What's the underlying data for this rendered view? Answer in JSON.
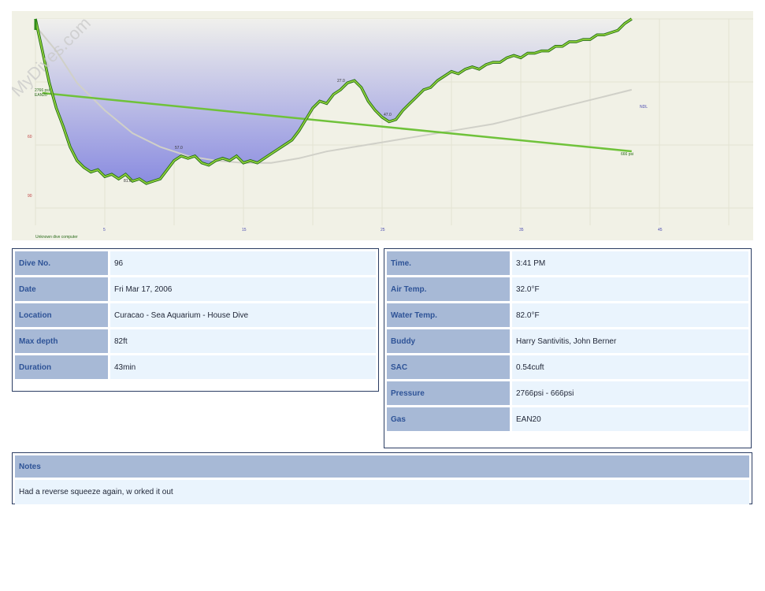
{
  "profile": {
    "watermark": "MyDives.com",
    "computer": "Unknown dive computer",
    "x_ticks": [
      "5",
      "15",
      "25",
      "35",
      "45"
    ],
    "y_ticks": [
      "60",
      "90"
    ],
    "labels": {
      "start_pressure": "2766 psi",
      "gas": "EAN20",
      "end_pressure": "666 psi",
      "ndl": "NDL",
      "max_depth": "81.0",
      "depth_mid": "57.0",
      "depth_rise": "47.0",
      "depth_peak": "27.0"
    },
    "colors": {
      "background": "#f1f1e6",
      "depth_line": "#2e8b1a",
      "depth_fill": "#8a8ce0",
      "pressure_line": "#6fc23a",
      "ndl_line": "#d0d0c8"
    },
    "depth_points": [
      [
        0.0,
        0
      ],
      [
        0.5,
        14
      ],
      [
        1.0,
        28
      ],
      [
        1.5,
        39
      ],
      [
        2.0,
        47
      ],
      [
        2.5,
        56
      ],
      [
        3.0,
        62
      ],
      [
        3.5,
        65
      ],
      [
        4.0,
        67
      ],
      [
        4.5,
        66
      ],
      [
        5.0,
        69
      ],
      [
        5.5,
        68
      ],
      [
        6.0,
        70
      ],
      [
        6.5,
        68
      ],
      [
        7.0,
        71
      ],
      [
        7.5,
        70
      ],
      [
        8.0,
        72
      ],
      [
        8.5,
        71
      ],
      [
        9.0,
        70
      ],
      [
        9.5,
        66
      ],
      [
        10.0,
        62
      ],
      [
        10.5,
        60
      ],
      [
        11.0,
        61
      ],
      [
        11.5,
        60
      ],
      [
        12.0,
        63
      ],
      [
        12.5,
        64
      ],
      [
        13.0,
        62
      ],
      [
        13.5,
        61
      ],
      [
        14.0,
        62
      ],
      [
        14.5,
        60
      ],
      [
        15.0,
        63
      ],
      [
        15.5,
        62
      ],
      [
        16.0,
        63
      ],
      [
        16.5,
        61
      ],
      [
        17.0,
        59
      ],
      [
        17.5,
        57
      ],
      [
        18.0,
        55
      ],
      [
        18.5,
        53
      ],
      [
        19.0,
        49
      ],
      [
        19.5,
        44
      ],
      [
        20.0,
        39
      ],
      [
        20.5,
        36
      ],
      [
        21.0,
        37
      ],
      [
        21.5,
        33
      ],
      [
        22.0,
        31
      ],
      [
        22.5,
        28
      ],
      [
        23.0,
        27
      ],
      [
        23.5,
        30
      ],
      [
        24.0,
        36
      ],
      [
        24.5,
        40
      ],
      [
        25.0,
        43
      ],
      [
        25.5,
        45
      ],
      [
        26.0,
        44
      ],
      [
        26.5,
        40
      ],
      [
        27.0,
        37
      ],
      [
        27.5,
        34
      ],
      [
        28.0,
        31
      ],
      [
        28.5,
        30
      ],
      [
        29.0,
        27
      ],
      [
        29.5,
        25
      ],
      [
        30.0,
        23
      ],
      [
        30.5,
        24
      ],
      [
        31.0,
        22
      ],
      [
        31.5,
        21
      ],
      [
        32.0,
        22
      ],
      [
        32.5,
        20
      ],
      [
        33.0,
        19
      ],
      [
        33.5,
        19
      ],
      [
        34.0,
        17
      ],
      [
        34.5,
        16
      ],
      [
        35.0,
        17
      ],
      [
        35.5,
        15
      ],
      [
        36.0,
        15
      ],
      [
        36.5,
        14
      ],
      [
        37.0,
        14
      ],
      [
        37.5,
        12
      ],
      [
        38.0,
        12
      ],
      [
        38.5,
        10
      ],
      [
        39.0,
        10
      ],
      [
        39.5,
        9
      ],
      [
        40.0,
        9
      ],
      [
        40.5,
        7
      ],
      [
        41.0,
        7
      ],
      [
        41.5,
        6
      ],
      [
        42.0,
        5
      ],
      [
        42.5,
        2
      ],
      [
        43.0,
        0
      ]
    ],
    "pressure_points": [
      [
        0.5,
        2766
      ],
      [
        43.0,
        666
      ]
    ],
    "ndl_points": [
      [
        0,
        3
      ],
      [
        1.5,
        14
      ],
      [
        3,
        28
      ],
      [
        5,
        40
      ],
      [
        7,
        50
      ],
      [
        9,
        56
      ],
      [
        11,
        60
      ],
      [
        13,
        62
      ],
      [
        15,
        63
      ],
      [
        17,
        63
      ],
      [
        19,
        61
      ],
      [
        21,
        58
      ],
      [
        23,
        56
      ],
      [
        25,
        54
      ],
      [
        27,
        52
      ],
      [
        29,
        50
      ],
      [
        31,
        48
      ],
      [
        33,
        46
      ],
      [
        35,
        43
      ],
      [
        37,
        40
      ],
      [
        39,
        37
      ],
      [
        41,
        34
      ],
      [
        43,
        31
      ]
    ]
  },
  "details": {
    "dive_no_label": "Dive No.",
    "dive_no": "96",
    "date_label": "Date",
    "date": "Fri Mar 17, 2006",
    "location_label": "Location",
    "location": "Curacao - Sea Aquarium - House Dive",
    "max_depth_label": "Max depth",
    "max_depth": "82ft",
    "duration_label": "Duration",
    "duration": "43min",
    "time_label": "Time.",
    "time": "3:41 PM",
    "air_temp_label": "Air Temp.",
    "air_temp": "32.0°F",
    "water_temp_label": "Water Temp.",
    "water_temp": "82.0°F",
    "buddy_label": "Buddy",
    "buddy": "Harry Santivitis, John Berner",
    "sac_label": "SAC",
    "sac": "0.54cuft",
    "pressure_label": "Pressure",
    "pressure": "2766psi - 666psi",
    "gas_label": "Gas",
    "gas": "EAN20"
  },
  "notes": {
    "label": "Notes",
    "text": "Had a reverse squeeze again, w orked it out"
  }
}
